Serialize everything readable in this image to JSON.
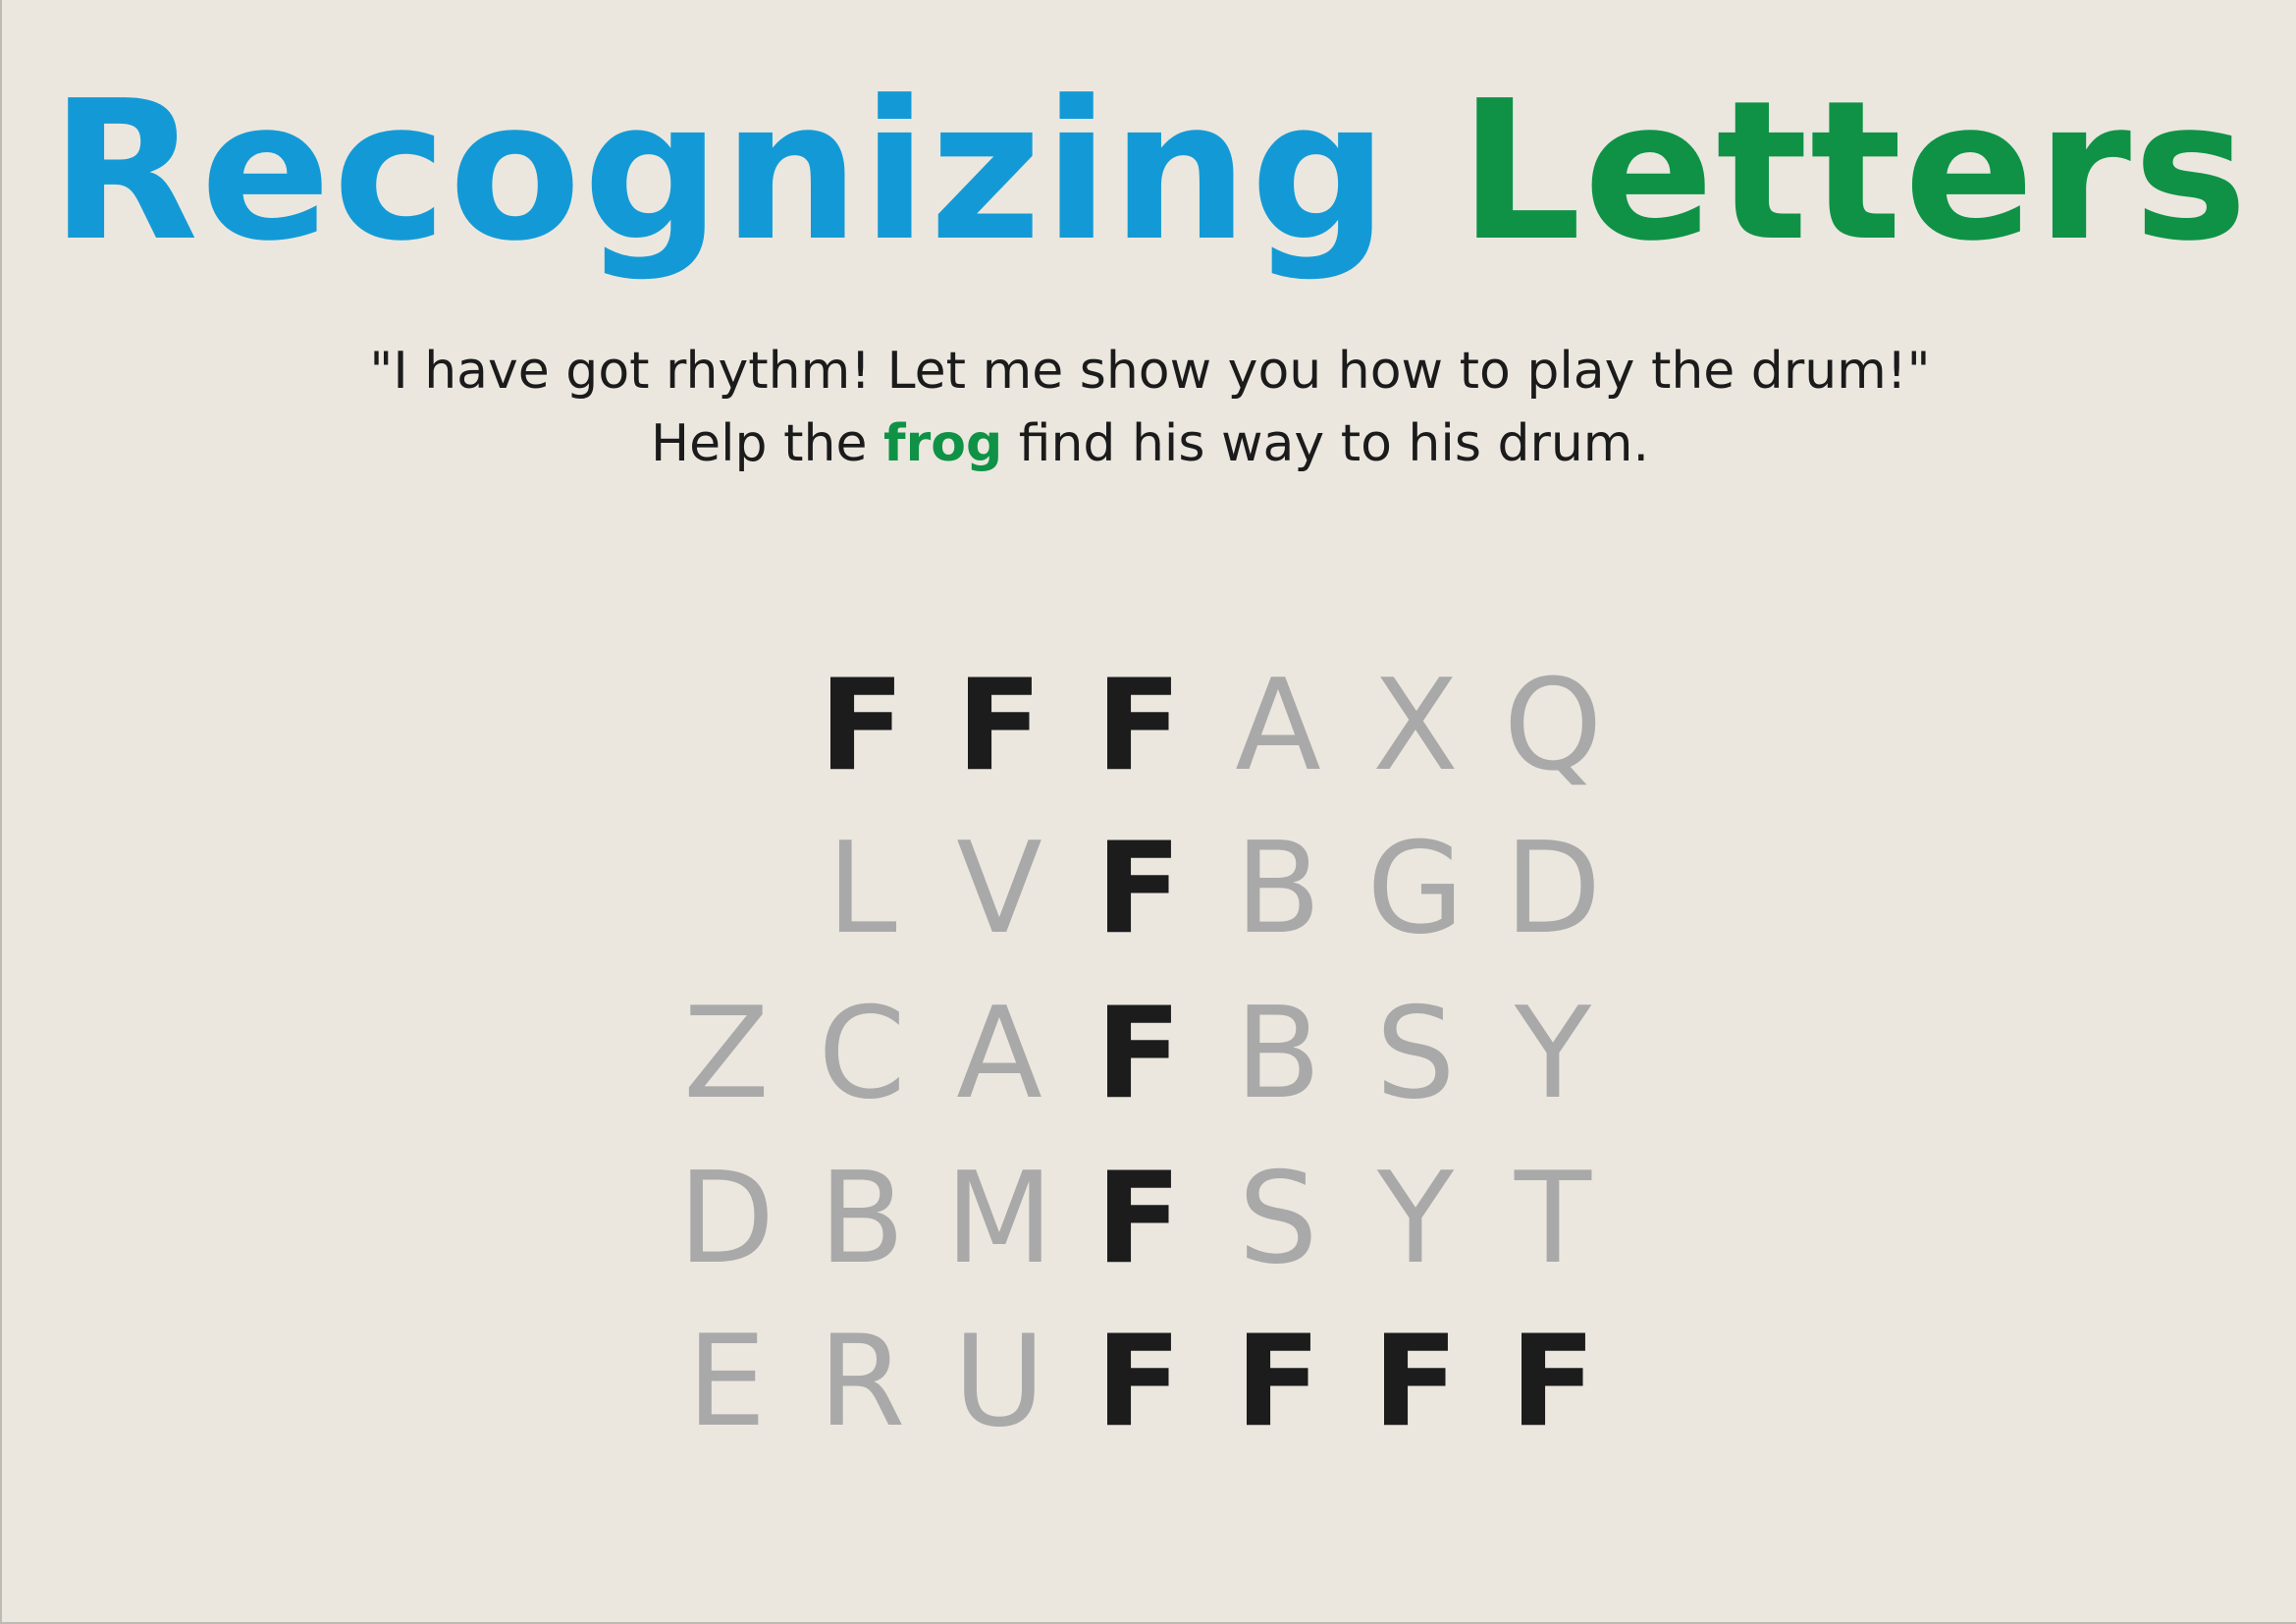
{
  "title": {
    "word1": "Recognizing",
    "word2": "Letters"
  },
  "subtitle": {
    "line1": "\"I have got rhythm! Let me show you how to play the drum!\"",
    "line2_before": "Help the",
    "line2_highlight": "frog",
    "line2_after": "find his way to his drum."
  },
  "colors": {
    "title_word1": "#139ad6",
    "title_word2": "#0f9246",
    "highlight": "#0f9246",
    "path_letter": "#1c1c1c",
    "other_letter": "#a9a9a9",
    "background": "#ebe7df"
  },
  "maze": {
    "rows": [
      [
        {
          "letter": "",
          "path": false
        },
        {
          "letter": "F",
          "path": true
        },
        {
          "letter": "F",
          "path": true
        },
        {
          "letter": "F",
          "path": true
        },
        {
          "letter": "A",
          "path": false
        },
        {
          "letter": "X",
          "path": false
        },
        {
          "letter": "Q",
          "path": false
        }
      ],
      [
        {
          "letter": "",
          "path": false
        },
        {
          "letter": "L",
          "path": false
        },
        {
          "letter": "V",
          "path": false
        },
        {
          "letter": "F",
          "path": true
        },
        {
          "letter": "B",
          "path": false
        },
        {
          "letter": "G",
          "path": false
        },
        {
          "letter": "D",
          "path": false
        }
      ],
      [
        {
          "letter": "Z",
          "path": false
        },
        {
          "letter": "C",
          "path": false
        },
        {
          "letter": "A",
          "path": false
        },
        {
          "letter": "F",
          "path": true
        },
        {
          "letter": "B",
          "path": false
        },
        {
          "letter": "S",
          "path": false
        },
        {
          "letter": "Y",
          "path": false
        }
      ],
      [
        {
          "letter": "D",
          "path": false
        },
        {
          "letter": "B",
          "path": false
        },
        {
          "letter": "M",
          "path": false
        },
        {
          "letter": "F",
          "path": true
        },
        {
          "letter": "S",
          "path": false
        },
        {
          "letter": "Y",
          "path": false
        },
        {
          "letter": "T",
          "path": false
        }
      ],
      [
        {
          "letter": "E",
          "path": false
        },
        {
          "letter": "R",
          "path": false
        },
        {
          "letter": "U",
          "path": false
        },
        {
          "letter": "F",
          "path": true
        },
        {
          "letter": "F",
          "path": true
        },
        {
          "letter": "F",
          "path": true
        },
        {
          "letter": "F",
          "path": true
        }
      ]
    ]
  }
}
